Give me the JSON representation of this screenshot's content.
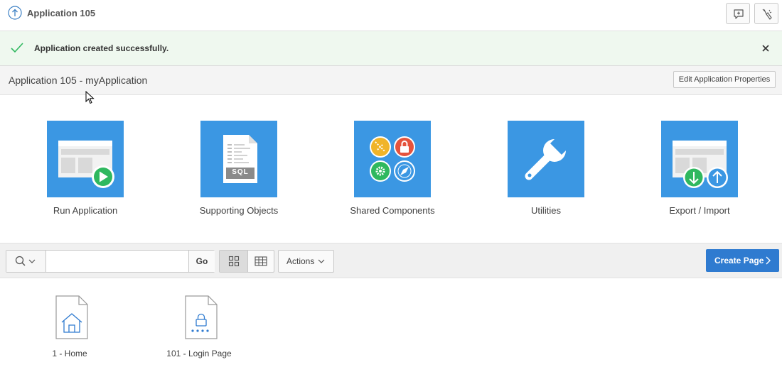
{
  "header": {
    "app_title": "Application 105",
    "buttons": [
      {
        "icon": "feedback-icon"
      },
      {
        "icon": "developer-toolbar-icon"
      }
    ]
  },
  "alert": {
    "message": "Application created successfully.",
    "color": "#eff8ef",
    "icon": "check-icon"
  },
  "app_bar": {
    "name": "Application 105 - myApplication",
    "edit_label": "Edit Application Properties"
  },
  "tiles": [
    {
      "label": "Run Application",
      "icon": "run-application-icon"
    },
    {
      "label": "Supporting Objects",
      "icon": "sql-script-icon",
      "badge": "SQL"
    },
    {
      "label": "Shared Components",
      "icon": "shared-components-icon"
    },
    {
      "label": "Utilities",
      "icon": "wrench-icon"
    },
    {
      "label": "Export / Import",
      "icon": "export-import-icon"
    }
  ],
  "toolbar": {
    "search_placeholder": "",
    "search_value": "",
    "go_label": "Go",
    "actions_label": "Actions",
    "create_label": "Create Page",
    "selected_view": "icons"
  },
  "pages": [
    {
      "label": "1 - Home",
      "icon": "home-page-icon"
    },
    {
      "label": "101 - Login Page",
      "icon": "login-page-icon"
    }
  ],
  "colors": {
    "tile_blue": "#3b97e3",
    "primary_button": "#2f7bd0",
    "success_green": "#2fb85f"
  }
}
